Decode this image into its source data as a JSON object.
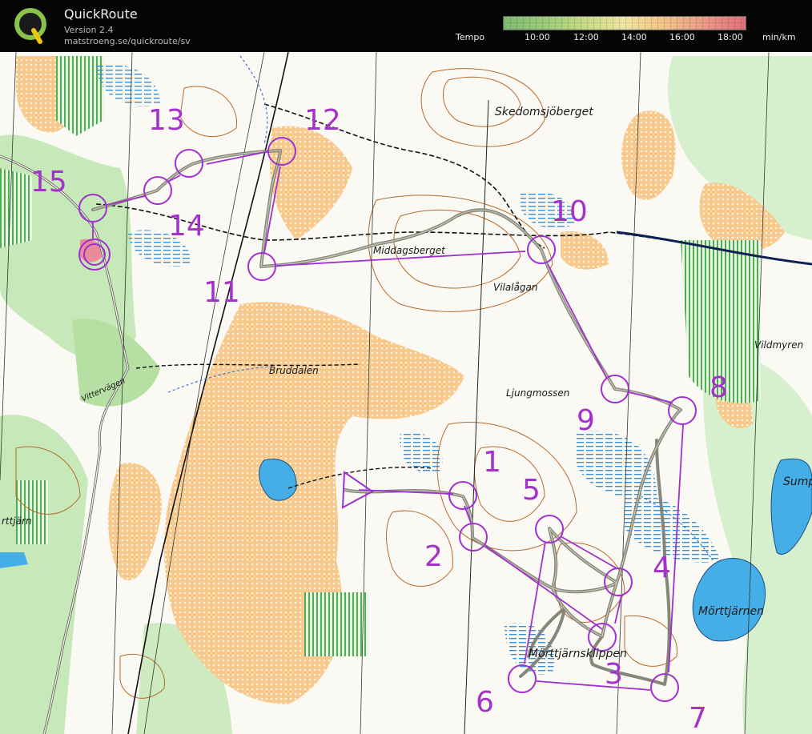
{
  "app": {
    "title": "QuickRoute",
    "version": "Version 2.4",
    "url": "matstroeng.se/quickroute/sv",
    "logo_letter": "Q"
  },
  "tempo": {
    "label": "Tempo",
    "ticks": [
      "10:00",
      "12:00",
      "14:00",
      "16:00",
      "18:00"
    ],
    "unit": "min/km"
  },
  "map": {
    "route_color": "#a030d0",
    "controls": [
      {
        "label": "1"
      },
      {
        "label": "2"
      },
      {
        "label": "3"
      },
      {
        "label": "4"
      },
      {
        "label": "5"
      },
      {
        "label": "6"
      },
      {
        "label": "7"
      },
      {
        "label": "8"
      },
      {
        "label": "9"
      },
      {
        "label": "10"
      },
      {
        "label": "11"
      },
      {
        "label": "12"
      },
      {
        "label": "13"
      },
      {
        "label": "14"
      },
      {
        "label": "15"
      }
    ],
    "places": {
      "skedomsjoberget": "Skedomsjöberget",
      "middagsberget": "Middagsberget",
      "vilalagan": "Vilalågan",
      "vildmyren": "Vildmyren",
      "bruddalen": "Bruddalen",
      "ljungmossen": "Ljungmossen",
      "vittervagen": "Vittervägen",
      "sump": "Sump",
      "morttjarnen": "Mörttjärnen",
      "morttjarnsklippen": "Mörttjärnsklippen",
      "rttjarn": "rttjärn"
    }
  }
}
